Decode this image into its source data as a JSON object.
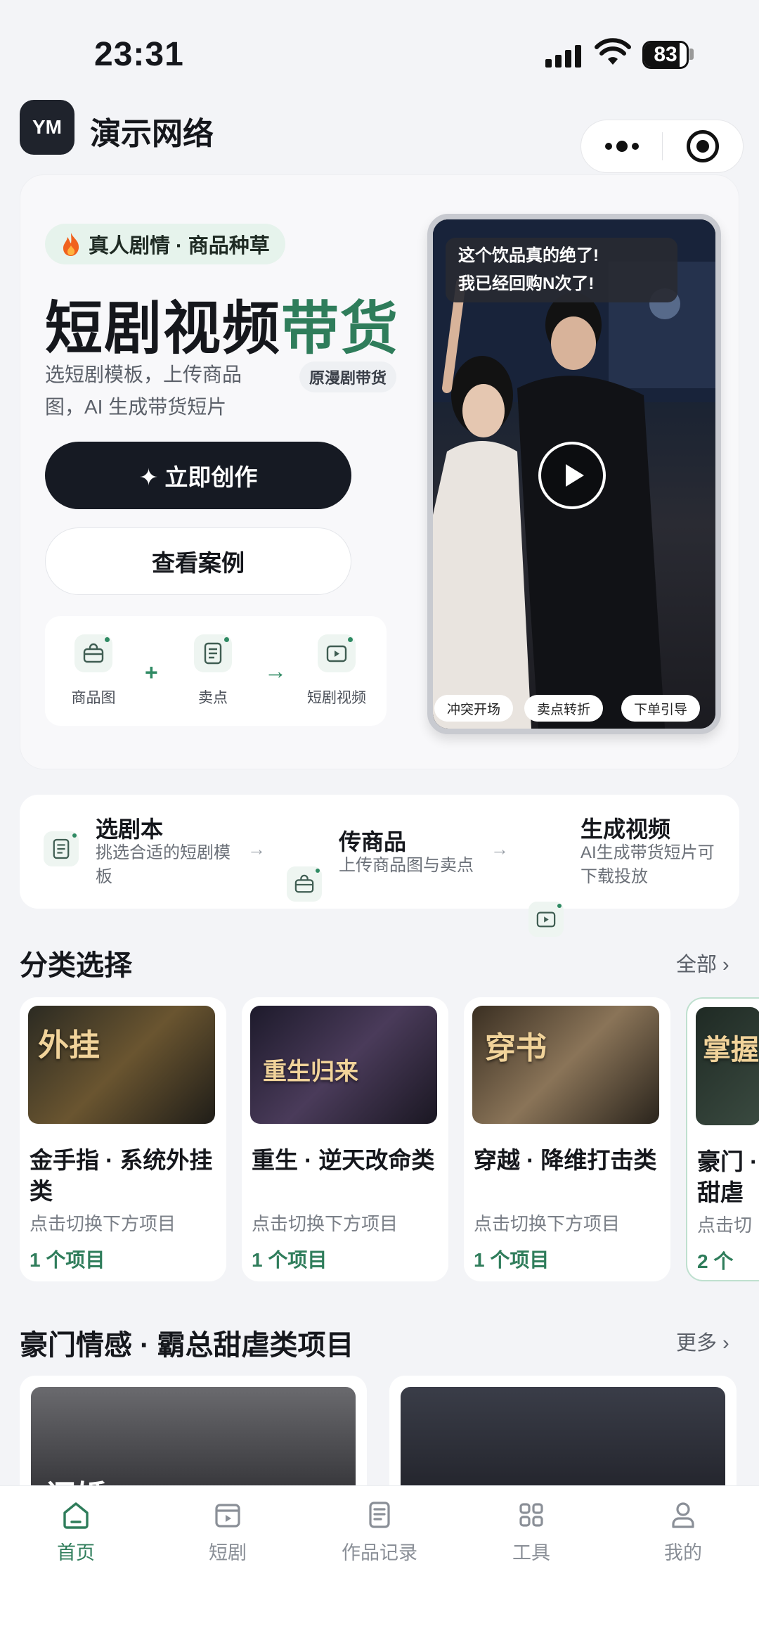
{
  "status_bar": {
    "time": "23:31",
    "battery": "83",
    "battery_level": 0.83
  },
  "header": {
    "logo": "YM",
    "title": "演示网络"
  },
  "hero": {
    "tag_icon": "fire-icon",
    "tag": "真人剧情 · 商品种草",
    "title_main": "短剧视频",
    "title_highlight": "带货",
    "description": "选短剧模板，上传商品图，AI 生成带货短片",
    "pill": "原漫剧带货",
    "primary_button": "✦ 立即创作",
    "secondary_button": "查看案例",
    "flow": [
      {
        "icon": "bag-icon",
        "label": "商品图"
      },
      {
        "icon": "document-icon",
        "label": "卖点"
      },
      {
        "icon": "video-icon",
        "label": "短剧视频"
      }
    ],
    "flow_plus": "+",
    "flow_arrow": "→",
    "preview": {
      "bubble_line1": "这个饮品真的绝了!",
      "bubble_line2": "我已经回购N次了!",
      "chips": [
        "冲突开场",
        "卖点转折",
        "下单引导"
      ]
    }
  },
  "steps": [
    {
      "icon": "document-icon",
      "title": "选剧本",
      "desc": "挑选合适的短剧模板"
    },
    {
      "icon": "bag-icon",
      "title": "传商品",
      "desc": "上传商品图与卖点"
    },
    {
      "icon": "video-icon",
      "title": "生成视频",
      "desc": "AI生成带货短片可下载投放"
    }
  ],
  "step_arrow": "→",
  "categories_section": {
    "title": "分类选择",
    "more": "全部 ›"
  },
  "categories": [
    {
      "name": "金手指 · 系统外挂类",
      "sub": "点击切换下方项目",
      "count": "1 个项目",
      "poster": "外挂"
    },
    {
      "name": "重生 · 逆天改命类",
      "sub": "点击切换下方项目",
      "count": "1 个项目",
      "poster": "重生归来"
    },
    {
      "name": "穿越 · 降维打击类",
      "sub": "点击切换下方项目",
      "count": "1 个项目",
      "poster": "穿书"
    },
    {
      "name": "豪门 · 甜虐",
      "sub": "点击切",
      "count": "2 个",
      "poster": "掌握"
    }
  ],
  "projects_section": {
    "title": "豪门情感 · 霸总甜虐类项目",
    "more": "更多 ›"
  },
  "projects": [
    {
      "poster": "闪婚"
    },
    {
      "poster": ""
    }
  ],
  "tabbar": [
    {
      "icon": "home-icon",
      "label": "首页",
      "active": true
    },
    {
      "icon": "clapper-icon",
      "label": "短剧",
      "active": false
    },
    {
      "icon": "record-icon",
      "label": "作品记录",
      "active": false
    },
    {
      "icon": "grid-icon",
      "label": "工具",
      "active": false
    },
    {
      "icon": "user-icon",
      "label": "我的",
      "active": false
    }
  ],
  "colors": {
    "accent": "#2f7d5b",
    "dark": "#161a23",
    "background": "#f3f4f7"
  }
}
